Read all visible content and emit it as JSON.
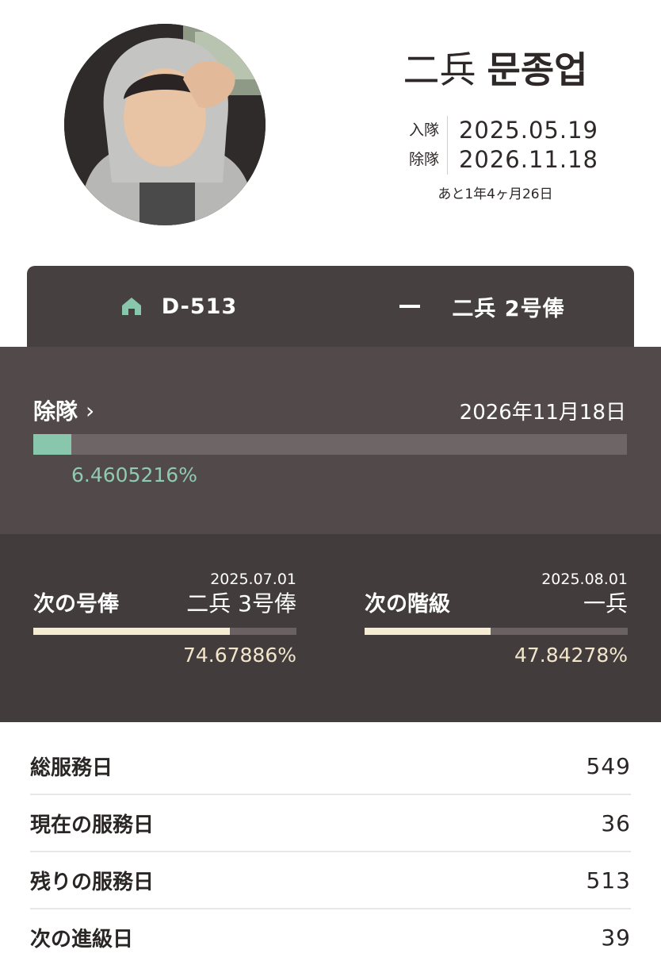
{
  "profile": {
    "rank": "二兵",
    "name": "문종업",
    "enlist_label": "入隊",
    "enlist_date": "2025.05.19",
    "discharge_label": "除隊",
    "discharge_date": "2026.11.18",
    "remaining": "あと1年4ヶ月26日"
  },
  "tabs": [
    {
      "icon": "home-icon",
      "label": "D-513"
    },
    {
      "icon": "rank-bar-icon",
      "label": "二兵 2号俸"
    }
  ],
  "discharge": {
    "label": "除隊",
    "date": "2026年11月18日",
    "progress_percent": 6.4605216,
    "percent_text": "6.4605216%"
  },
  "next": [
    {
      "title": "次の号俸",
      "date": "2025.07.01",
      "target": "二兵 3号俸",
      "progress_percent": 74.67886,
      "percent_text": "74.67886%"
    },
    {
      "title": "次の階級",
      "date": "2025.08.01",
      "target": "一兵",
      "progress_percent": 47.84278,
      "percent_text": "47.84278%"
    }
  ],
  "stats": [
    {
      "label": "総服務日",
      "value": "549"
    },
    {
      "label": "現在の服務日",
      "value": "36"
    },
    {
      "label": "残りの服務日",
      "value": "513"
    },
    {
      "label": "次の進級日",
      "value": "39"
    }
  ],
  "colors": {
    "accent_green": "#89c7ad",
    "cream": "#f6ecd4",
    "dark_panel": "#474040"
  }
}
